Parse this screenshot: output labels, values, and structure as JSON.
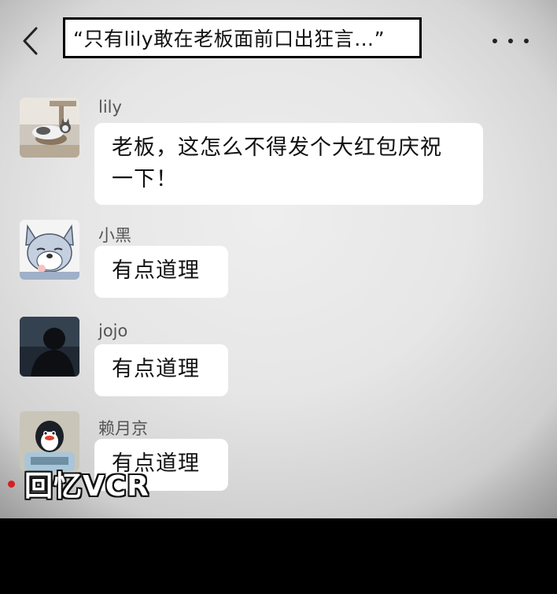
{
  "header": {
    "title": "“只有lily敢在老板面前口出狂言…”",
    "back_icon": "chevron-left-icon",
    "more_icon": "more-horizontal-icon"
  },
  "messages": [
    {
      "sender": "lily",
      "lines": [
        "老板，这怎么不得发个大红包庆祝",
        "一下！"
      ],
      "avatar": "cat-photo-avatar"
    },
    {
      "sender": "小黑",
      "lines": [
        "有点道理"
      ],
      "avatar": "cartoon-dog-avatar"
    },
    {
      "sender": "jojo",
      "lines": [
        "有点道理"
      ],
      "avatar": "silhouette-avatar"
    },
    {
      "sender": "赖月京",
      "lines": [
        "有点道理"
      ],
      "avatar": "penguin-avatar"
    }
  ],
  "overlay": {
    "label": "回忆VCR",
    "rec_color": "#d81e1e"
  }
}
